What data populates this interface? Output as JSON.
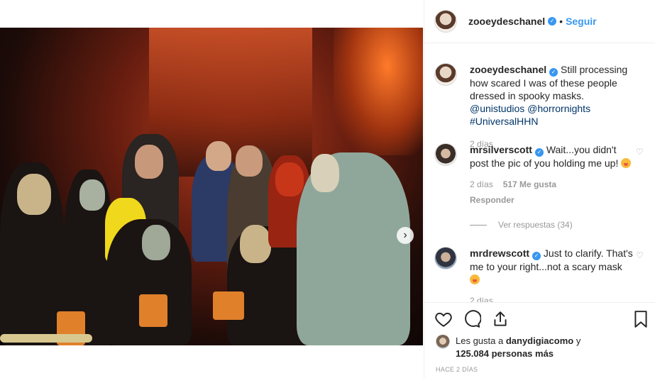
{
  "post": {
    "author": "zooeydeschanel",
    "follow_label": "Seguir",
    "dot": "•",
    "verified_mark": "✓",
    "caption_text": "Still processing how scared I was of these people dressed in spooky masks.",
    "caption_mention": "@unistudios",
    "caption_tags": "@horrornights #UniversalHHN",
    "caption_time": "2 días",
    "next_icon": "›"
  },
  "comments": [
    {
      "user": "mrsilverscott",
      "text": "Wait...you didn't post the pic of you holding me up!",
      "time": "2 días",
      "likes": "517 Me gusta",
      "reply": "Responder"
    },
    {
      "user": "mrdrewscott",
      "text": "Just to clarify. That's me to your right...not a scary mask",
      "time": "2 días",
      "likes": "",
      "reply": ""
    }
  ],
  "view_replies": "Ver respuestas (34)",
  "likes_line": {
    "prefix": "Les gusta a",
    "user": "danydigiacomo",
    "conj": "y",
    "count": "125.084 personas más"
  },
  "post_time": "HACE 2 DÍAS",
  "icons": {
    "like": "heart-icon",
    "comment": "comment-icon",
    "share": "share-icon",
    "save": "bookmark-icon",
    "next": "chevron-right-icon"
  }
}
